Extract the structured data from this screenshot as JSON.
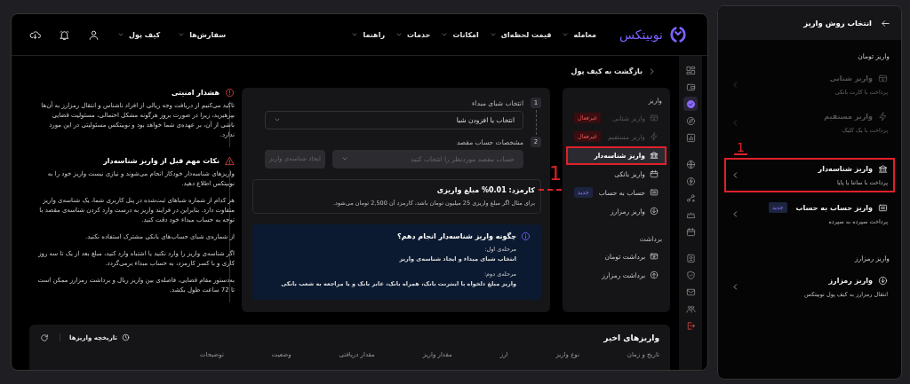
{
  "nav": {
    "logo": "نوبیتکس",
    "menu": [
      {
        "label": "معامله"
      },
      {
        "label": "قیمت لحظه‌ای"
      },
      {
        "label": "امکانات"
      },
      {
        "label": "خدمات"
      },
      {
        "label": "راهنما"
      }
    ],
    "account_menu": [
      {
        "label": "سفارش‌ها"
      },
      {
        "label": "کیف پول"
      }
    ]
  },
  "back_link": "بازگشت به کیف پول",
  "deposit_menu": {
    "sections": [
      {
        "title": "واریز",
        "items": [
          {
            "kind": "card",
            "label": "واریز شتابی",
            "disabled": true,
            "selected": false,
            "annotated": false,
            "badge": {
              "kind": "inactive",
              "text": "غیرفعال"
            }
          },
          {
            "kind": "bolt",
            "label": "واریز مستقیم",
            "disabled": true,
            "selected": false,
            "annotated": false,
            "badge": {
              "kind": "inactive",
              "text": "غیرفعال"
            }
          },
          {
            "kind": "bank",
            "label": "واریز شناسه‌دار",
            "disabled": false,
            "selected": true,
            "annotated": true
          },
          {
            "kind": "calendar",
            "label": "واریز بانکی",
            "disabled": false,
            "selected": false,
            "annotated": false
          },
          {
            "kind": "transfer",
            "label": "حساب به حساب",
            "disabled": false,
            "selected": false,
            "annotated": false,
            "badge": {
              "kind": "new",
              "text": "جدید"
            }
          },
          {
            "kind": "download",
            "label": "واریز رمزارز",
            "disabled": false,
            "selected": false,
            "annotated": false
          }
        ]
      },
      {
        "title": "برداشت",
        "items": [
          {
            "kind": "card-plus",
            "label": "برداشت تومان",
            "disabled": false,
            "selected": false,
            "annotated": false
          },
          {
            "kind": "upload",
            "label": "برداشت رمزارز",
            "disabled": false,
            "selected": false,
            "annotated": false
          }
        ]
      }
    ]
  },
  "form": {
    "steps": [
      {
        "number": "1",
        "label": "انتخاب شبای مبداء",
        "select": {
          "placeholder": "انتخاب یا افزودن شبا",
          "disabled": false
        }
      },
      {
        "number": "2",
        "label": "مشخصات حساب مقصد",
        "select": {
          "placeholder": "حساب مقصد موردنظر را انتخاب کنید",
          "disabled": true
        },
        "button": {
          "label": "ایجاد شناسه‌ی واریز",
          "disabled": true
        }
      }
    ],
    "fee": {
      "title": "کارمزد: 0.01% مبلغ واریزی",
      "example": "برای مثال اگر مبلغ واریزی 25 میلیون تومان باشد، کارمزد آن 2,500 تومان می‌شود."
    },
    "guide": {
      "title": "چگونه واریز شناسه‌دار انجام دهم؟",
      "stages": [
        {
          "heading": "مرحله‌ی اول:",
          "text": "انتخاب شبای مبداء و ایجاد شناسه‌ی واریز"
        },
        {
          "heading": "مرحله‌ی دوم:",
          "text": "واریز مبلغ دلخواه با اینترنت بانک، همراه بانک، عابر بانک و یا مراجعه به شعب بانکی"
        }
      ]
    }
  },
  "warnings": [
    {
      "kind": "security",
      "title": "هشدار امنیتی",
      "paragraphs": [
        "تاکید می‌کنیم از دریافت وجه ریالی از افراد ناشناس و انتقال رمزارز به آن‌ها بپرهیزید، زیرا در صورت بروز هرگونه مشکل احتمالی، مسئولیت قضایی ناشی از آن، بر عهده‌ی شما خواهد بود و نوبیتکس مسئولیتی در این مورد ندارد."
      ]
    },
    {
      "kind": "notes",
      "title": "نکات مهم قبل از واریز شناسه‌دار",
      "paragraphs": [
        "واریزهای شناسه‌دار خودکار انجام می‌شوند و نیازی نیست واریز خود را به نوبیتکس اطلاع دهید.",
        "هر کدام از شماره شباهای ثبت‌شده در پنل کاربری شما، یک شناسه‌ی واریز متفاوت دارد. بنابراین در فرایند واریز به درست وارد کردن شناسه‌ی مقصد با توجه به حساب مبداء خود دقت کنید.",
        "از شماره‌ی شبای حساب‌های بانکی مشترک استفاده نکنید.",
        "اگر شناسه‌ی واریز را وارد نکنید یا اشتباه وارد کنید، مبلغ بعد از یک تا سه روز کاری و با کسر کارمزد، به حساب مبداء برمی‌گردد.",
        "به‌دستور مقام قضایی، فاصله‌ی بین واریز ریال و برداشت رمزارز ممکن است تا 72 ساعت طول بکشد."
      ]
    }
  ],
  "recent": {
    "title": "واریزهای اخیر",
    "history_button": "تاریخچه واریزها",
    "columns": [
      "تاریخ و زمان",
      "نوع واریز",
      "ارز",
      "مقدار واریز",
      "مقدار دریافتی",
      "وضعیت",
      "توضیحات"
    ]
  },
  "rail": [
    [
      {
        "kind": "grid",
        "selected": false
      },
      {
        "kind": "wallet",
        "selected": false
      },
      {
        "kind": "check",
        "selected": true
      },
      {
        "kind": "compass",
        "selected": false
      },
      {
        "kind": "chart",
        "selected": false
      }
    ],
    [
      {
        "kind": "globe",
        "selected": false
      },
      {
        "kind": "bolt-circle",
        "selected": false
      },
      {
        "kind": "nodes",
        "selected": false
      },
      {
        "kind": "crown",
        "selected": false
      },
      {
        "kind": "calendar",
        "selected": false
      }
    ],
    [
      {
        "kind": "id-card",
        "selected": false
      },
      {
        "kind": "shield",
        "selected": false
      },
      {
        "kind": "mail",
        "selected": false
      },
      {
        "kind": "group",
        "selected": false
      },
      {
        "kind": "logout",
        "selected": false
      }
    ]
  ],
  "panel": {
    "title": "انتخاب روش واریز",
    "sections": [
      {
        "title": "واریز تومان",
        "items": [
          {
            "kind": "card",
            "title": "واریز شتابی",
            "subtitle": "پرداخت با کارت بانکی",
            "disabled": true,
            "annotated": false
          },
          {
            "kind": "bolt",
            "title": "واریز مستقیم",
            "subtitle": "پرداخت با یک کلیک",
            "disabled": true,
            "annotated": false
          },
          {
            "kind": "bank",
            "title": "واریز شناسه‌دار",
            "subtitle": "پرداخت با ساتنا یا پایا",
            "disabled": false,
            "annotated": true
          },
          {
            "kind": "transfer",
            "title": "واریز حساب به حساب",
            "subtitle": "پرداخت سپرده به سپرده",
            "disabled": false,
            "annotated": false,
            "badge": {
              "kind": "new",
              "text": "جدید"
            }
          }
        ]
      },
      {
        "title": "واریز رمزارز",
        "items": [
          {
            "kind": "download",
            "title": "واریز رمزارز",
            "subtitle": "انتقال رمزارز به کیف پول نوبیتکس",
            "disabled": false,
            "annotated": false
          }
        ]
      }
    ]
  },
  "annotations": [
    {
      "kind": "leader",
      "label": "1"
    },
    {
      "kind": "underlined",
      "label": "1"
    }
  ]
}
